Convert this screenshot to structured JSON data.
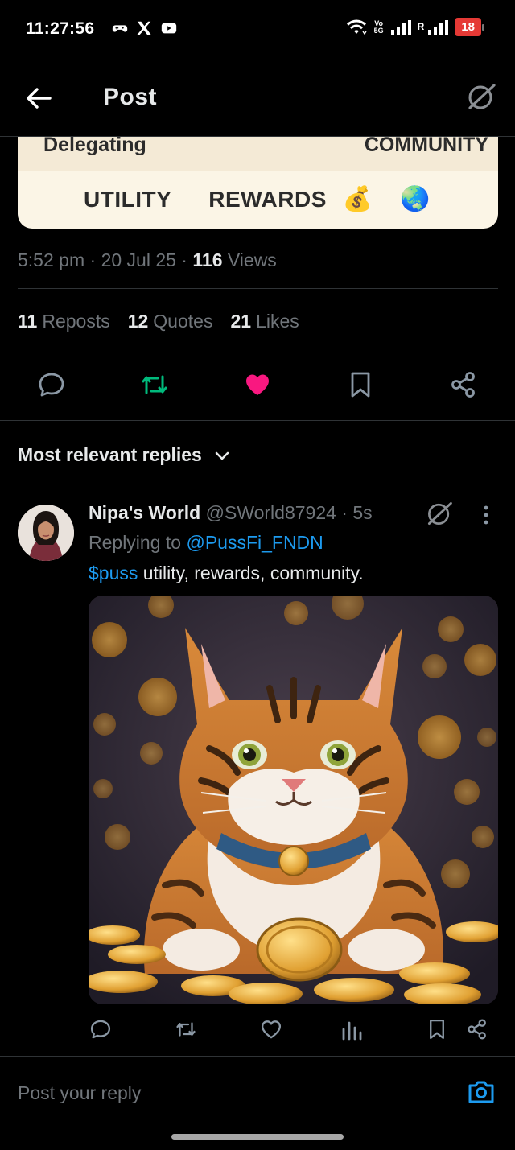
{
  "status_bar": {
    "time": "11:27:56",
    "battery": "18",
    "net_top": "Vo",
    "net_bottom": "5G",
    "roaming": "R"
  },
  "header": {
    "title": "Post"
  },
  "promo_image": {
    "top_left_text": "Delegating",
    "top_right_text": "COMMUNITY",
    "words": [
      "UTILITY",
      "REWARDS"
    ],
    "emoji_bag": "💰",
    "emoji_globe": "🌏"
  },
  "post_meta": {
    "time": "5:52 pm",
    "sep1": " · ",
    "date": "20 Jul 25",
    "sep2": " · ",
    "views_count": "116",
    "views_label": " Views"
  },
  "stats": {
    "reposts_count": "11",
    "reposts_label": "Reposts",
    "quotes_count": "12",
    "quotes_label": "Quotes",
    "likes_count": "21",
    "likes_label": "Likes"
  },
  "sort": {
    "label": "Most relevant replies"
  },
  "reply": {
    "name": "Nipa's World",
    "handle": " @SWorld87924",
    "time": " · 5s",
    "replying_prefix": "Replying to ",
    "replying_handle": "@PussFi_FNDN",
    "cashtag": "$puss",
    "text": " utility, rewards, community."
  },
  "compose": {
    "placeholder": "Post your reply"
  },
  "colors": {
    "accent_blue": "#1d9bf0",
    "like_pink": "#f91880",
    "repost_green": "#00ba7c",
    "muted": "#71767b"
  }
}
